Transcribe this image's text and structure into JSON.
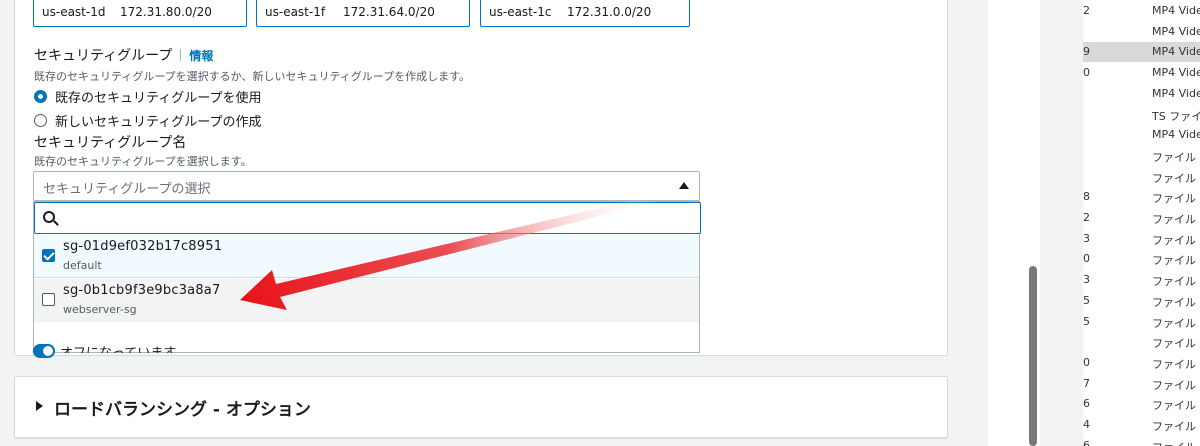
{
  "subnets": [
    {
      "az": "us-east-1d",
      "cidr": "172.31.80.0/20"
    },
    {
      "az": "us-east-1f",
      "cidr": "172.31.64.0/20"
    },
    {
      "az": "us-east-1c",
      "cidr": "172.31.0.0/20"
    }
  ],
  "security_group": {
    "label": "セキュリティグループ",
    "info_link": "情報",
    "description": "既存のセキュリティグループを選択するか、新しいセキュリティグループを作成します。",
    "radio_existing": "既存のセキュリティグループを使用",
    "radio_new": "新しいセキュリティグループの作成",
    "name_label": "セキュリティグループ名",
    "name_description": "既存のセキュリティグループを選択します。",
    "select_placeholder": "セキュリティグループの選択",
    "options": [
      {
        "id": "sg-01d9ef032b17c8951",
        "name": "default",
        "checked": true
      },
      {
        "id": "sg-0b1cb9f3e9bc3a8a7",
        "name": "webserver-sg",
        "checked": false
      }
    ]
  },
  "below_dropdown_text": "オフになっています",
  "load_balancing": {
    "title": "ロードバランシング - オプション"
  },
  "file_list": [
    {
      "num": "2",
      "name": "MP4 Vide"
    },
    {
      "num": "",
      "name": "MP4 Vide"
    },
    {
      "num": "9",
      "name": "MP4 Vide",
      "selected": true
    },
    {
      "num": "0",
      "name": "MP4 Vide"
    },
    {
      "num": "",
      "name": "MP4 Vide"
    },
    {
      "num": "",
      "name": "TS ファイル"
    },
    {
      "num": "",
      "name": "MP4 Vide"
    },
    {
      "num": "",
      "name": "ファイル フ"
    },
    {
      "num": "",
      "name": "ファイル フ"
    },
    {
      "num": "8",
      "name": "ファイル フ"
    },
    {
      "num": "2",
      "name": "ファイル フ"
    },
    {
      "num": "3",
      "name": "ファイル フ"
    },
    {
      "num": "0",
      "name": "ファイル フ"
    },
    {
      "num": "3",
      "name": "ファイル フ"
    },
    {
      "num": "5",
      "name": "ファイル フ"
    },
    {
      "num": "5",
      "name": "ファイル フ"
    },
    {
      "num": "",
      "name": "ファイル フ"
    },
    {
      "num": "0",
      "name": "ファイル フ"
    },
    {
      "num": "7",
      "name": "ファイル フ"
    },
    {
      "num": "6",
      "name": "ファイル フ"
    },
    {
      "num": "4",
      "name": "ファイル フ"
    },
    {
      "num": "6",
      "name": "ファイル フ"
    }
  ]
}
